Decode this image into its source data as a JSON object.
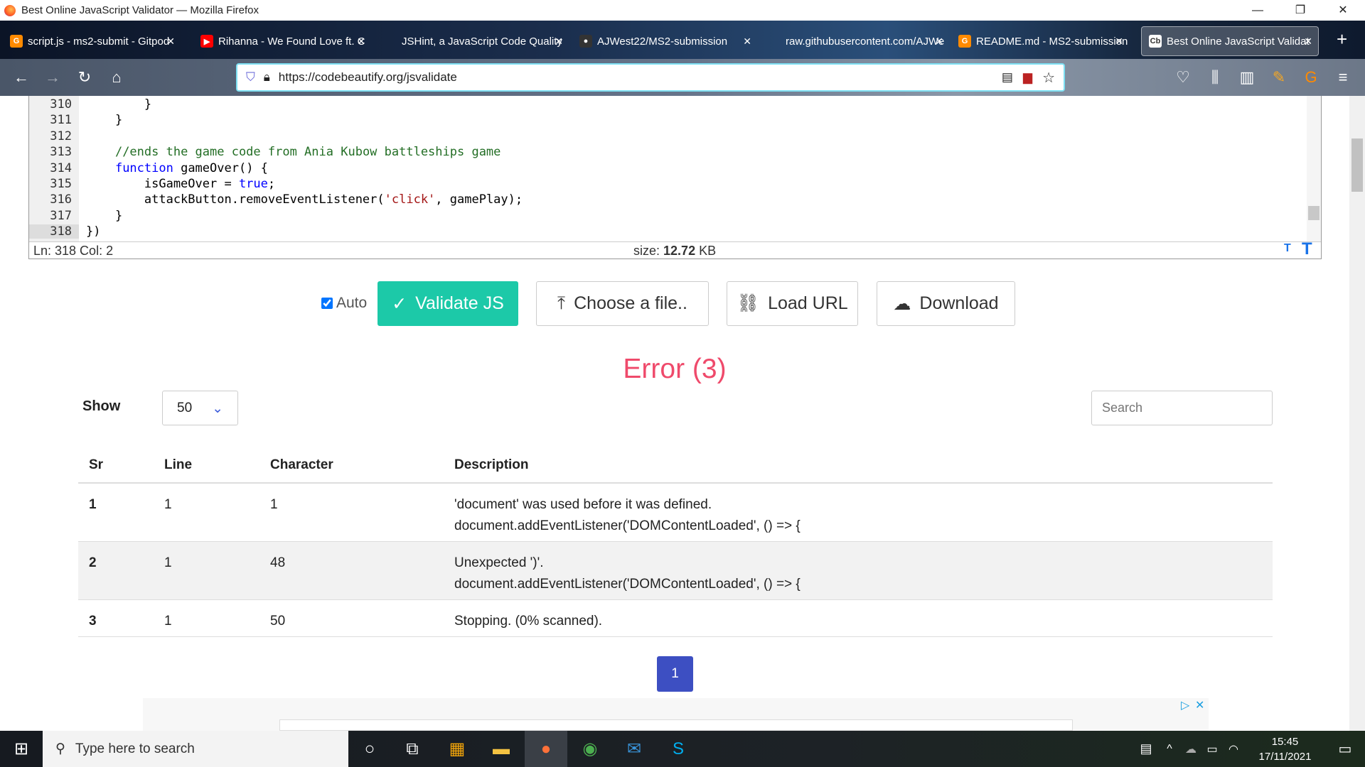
{
  "window": {
    "title": "Best Online JavaScript Validator — Mozilla Firefox"
  },
  "tabs": [
    {
      "label": "script.js - ms2-submit - Gitpod",
      "icon": "gitpod-icon"
    },
    {
      "label": "Rihanna - We Found Love ft. C",
      "icon": "youtube-icon"
    },
    {
      "label": "JSHint, a JavaScript Code Quality",
      "icon": "jshint-icon"
    },
    {
      "label": "AJWest22/MS2-submission",
      "icon": "github-icon"
    },
    {
      "label": "raw.githubusercontent.com/AJWe",
      "icon": "page-icon"
    },
    {
      "label": "README.md - MS2-submission",
      "icon": "gitpod-icon"
    },
    {
      "label": "Best Online JavaScript Validat",
      "icon": "codebeautify-icon",
      "active": true
    }
  ],
  "url": "https://codebeautify.org/jsvalidate",
  "editor": {
    "lines": [
      {
        "n": "310",
        "html": "        }"
      },
      {
        "n": "311",
        "html": "    }"
      },
      {
        "n": "312",
        "html": ""
      },
      {
        "n": "313",
        "html": "    <span class=\"cm\">//ends the game code from Ania Kubow battleships game</span>"
      },
      {
        "n": "314",
        "html": "    <span class=\"kw\">function</span> gameOver() {"
      },
      {
        "n": "315",
        "html": "        isGameOver = <span class=\"kw\">true</span>;"
      },
      {
        "n": "316",
        "html": "        attackButton.removeEventListener(<span class=\"st\">'click'</span>, gamePlay);"
      },
      {
        "n": "317",
        "html": "    }"
      },
      {
        "n": "318",
        "html": "})"
      }
    ],
    "position": "Ln: 318 Col: 2",
    "size_label": "size:",
    "size_value": "12.72",
    "size_unit": "KB"
  },
  "actions": {
    "auto": "Auto",
    "validate": "Validate JS",
    "choose": "Choose a file..",
    "load": "Load URL",
    "download": "Download"
  },
  "result": {
    "title": "Error (3)",
    "show_label": "Show",
    "show_value": "50",
    "search_placeholder": "Search"
  },
  "table": {
    "headers": [
      "Sr",
      "Line",
      "Character",
      "Description"
    ],
    "rows": [
      {
        "sr": "1",
        "line": "1",
        "char": "1",
        "desc": "'document' was used before it was defined.",
        "evidence": "document.addEventListener('DOMContentLoaded', () => {"
      },
      {
        "sr": "2",
        "line": "1",
        "char": "48",
        "desc": "Unexpected ')'.",
        "evidence": "document.addEventListener('DOMContentLoaded', () => {"
      },
      {
        "sr": "3",
        "line": "1",
        "char": "50",
        "desc": "Stopping. (0% scanned).",
        "evidence": ""
      }
    ]
  },
  "pagination": {
    "current": "1"
  },
  "taskbar": {
    "search_placeholder": "Type here to search",
    "time": "15:45",
    "date": "17/11/2021"
  }
}
